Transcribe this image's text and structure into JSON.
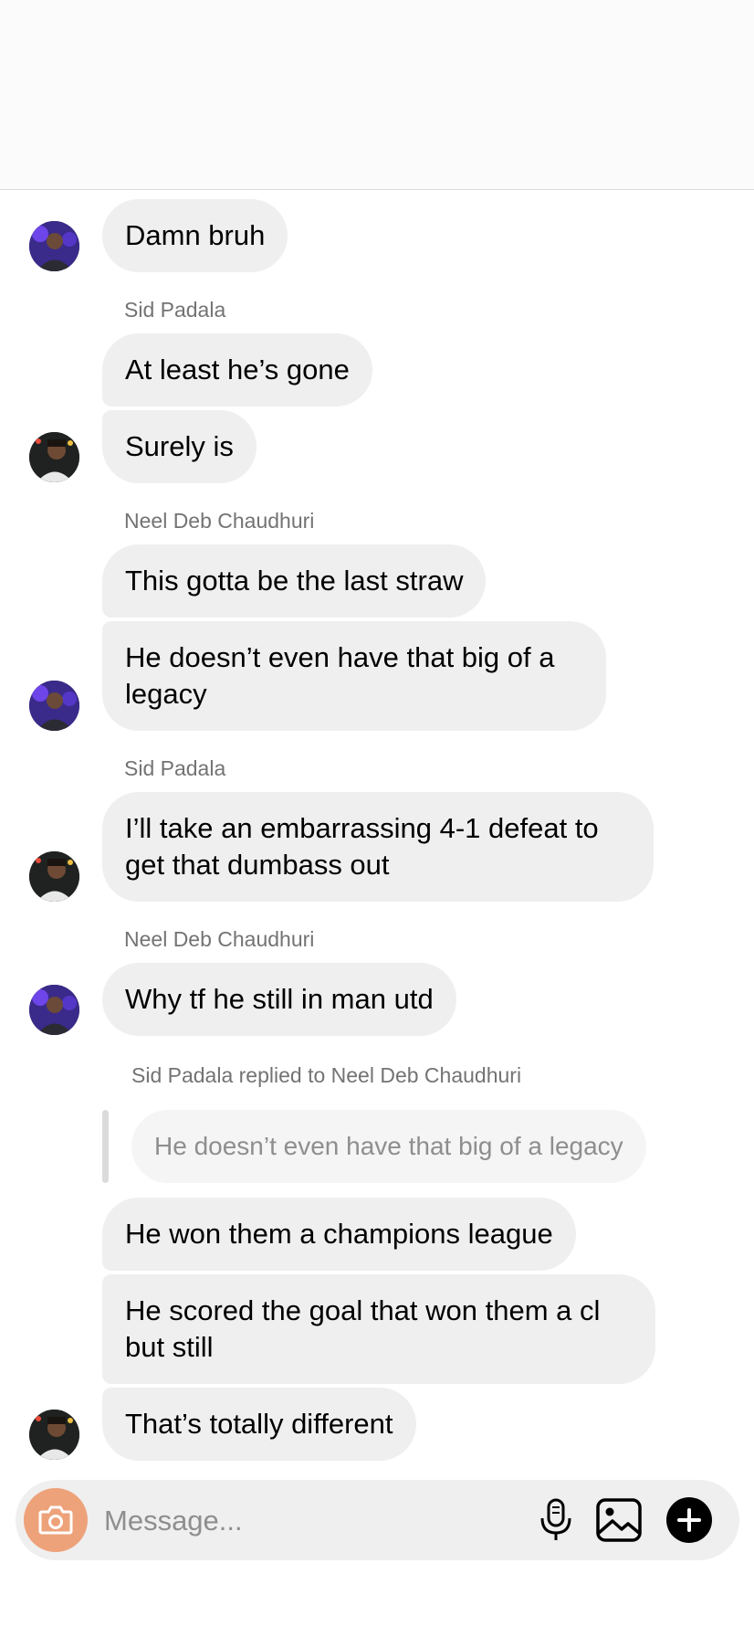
{
  "messages": [
    {
      "text": "Damn bruh"
    },
    {
      "sender": "Sid Padala",
      "text": "At least he’s gone"
    },
    {
      "text": "Surely is"
    },
    {
      "sender": "Neel Deb Chaudhuri",
      "text": "This gotta be the last straw"
    },
    {
      "text": "He doesn’t even have that big of a legacy"
    },
    {
      "sender": "Sid Padala",
      "text": "I’ll take an embarrassing 4-1 defeat to get that dumbass out"
    },
    {
      "sender": "Neel Deb Chaudhuri",
      "text": "Why tf he still in man utd"
    },
    {
      "text": "He won them a champions league"
    },
    {
      "text": "He scored the goal that won them a cl but still"
    },
    {
      "text": "That’s totally different"
    }
  ],
  "reply": {
    "meta": "Sid Padala replied to Neel Deb Chaudhuri",
    "quote": "He doesn’t even have that big of a legacy"
  },
  "composer": {
    "placeholder": "Message...",
    "icons": [
      "camera-icon",
      "microphone-icon",
      "gallery-icon",
      "plus-icon"
    ]
  },
  "colors": {
    "bubble": "#efefef",
    "camera_button": "#eea27a",
    "secondary_text": "#737373"
  }
}
